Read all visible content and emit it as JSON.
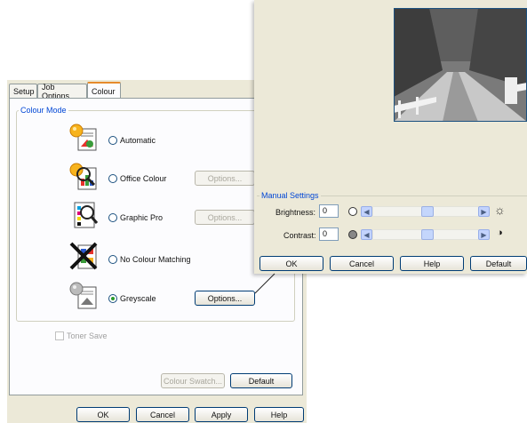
{
  "main_dialog": {
    "tabs": [
      {
        "label": "Setup"
      },
      {
        "label": "Job Options"
      },
      {
        "label": "Colour"
      }
    ],
    "group_title": "Colour Mode",
    "modes": [
      {
        "label": "Automatic",
        "checked": false,
        "options": null,
        "icon": "colour-auto-icon"
      },
      {
        "label": "Office Colour",
        "checked": false,
        "options": "Options...",
        "icon": "office-colour-icon"
      },
      {
        "label": "Graphic Pro",
        "checked": false,
        "options": "Options...",
        "icon": "graphic-pro-icon"
      },
      {
        "label": "No Colour Matching",
        "checked": false,
        "options": null,
        "icon": "no-colour-matching-icon"
      },
      {
        "label": "Greyscale",
        "checked": true,
        "options": "Options...",
        "icon": "greyscale-icon"
      }
    ],
    "toner_save": "Toner Save",
    "colour_swatch": "Colour Swatch...",
    "default": "Default",
    "buttons": {
      "ok": "OK",
      "cancel": "Cancel",
      "apply": "Apply",
      "help": "Help"
    }
  },
  "greyscale_dialog": {
    "preview_image": "tree-lined-lane-photo",
    "manual_settings_title": "Manual Settings",
    "brightness": {
      "label": "Brightness:",
      "value": "0",
      "icon_low": "empty-circle-icon",
      "icon_high": "sun-icon"
    },
    "contrast": {
      "label": "Contrast:",
      "value": "0",
      "icon_low": "filled-circle-icon",
      "icon_high": "half-circle-icon"
    },
    "buttons": {
      "ok": "OK",
      "cancel": "Cancel",
      "help": "Help",
      "default": "Default"
    }
  }
}
